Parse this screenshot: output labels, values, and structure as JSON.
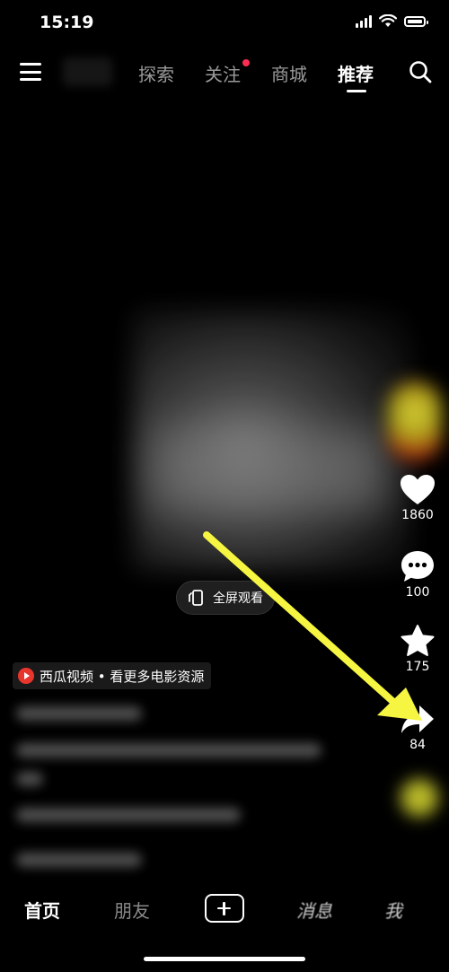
{
  "status_bar": {
    "time": "15:19"
  },
  "top_nav": {
    "tabs": [
      {
        "label": "探索",
        "active": false
      },
      {
        "label": "关注",
        "active": false,
        "has_dot": true
      },
      {
        "label": "商城",
        "active": false
      },
      {
        "label": "推荐",
        "active": true
      }
    ],
    "icons": {
      "menu": "menu-icon",
      "search": "search-icon"
    }
  },
  "video": {
    "fullscreen_label": "全屏观看"
  },
  "sidebar": {
    "like_count": "1860",
    "comment_count": "100",
    "favorite_count": "175",
    "share_count": "84"
  },
  "caption": {
    "source_label": "西瓜视频 • 看更多电影资源"
  },
  "bottom_nav": {
    "home": "首页",
    "friends": "朋友",
    "messages": "消息",
    "me": "我"
  },
  "colors": {
    "background": "#000000",
    "accent_dot": "#ff2c55",
    "arrow": "#f5f542",
    "source_logo": "#e8362d"
  }
}
